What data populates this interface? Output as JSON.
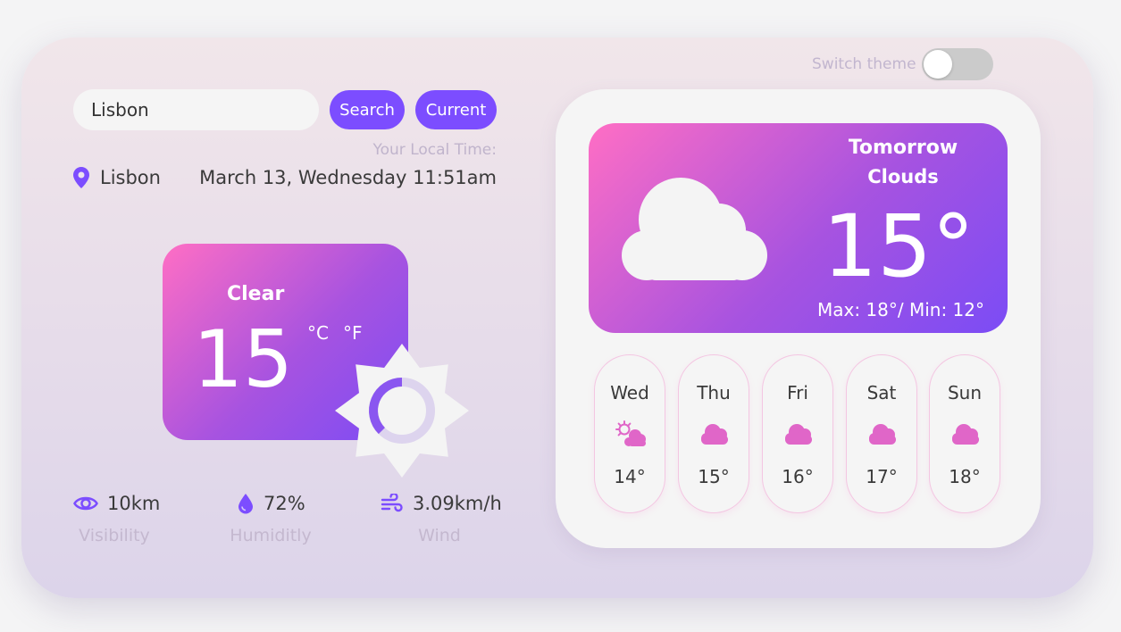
{
  "theme": {
    "label": "Switch theme",
    "dark_mode": false
  },
  "search": {
    "value": "Lisbon",
    "search_label": "Search",
    "current_label": "Current"
  },
  "location": {
    "city": "Lisbon",
    "local_time_label": "Your Local Time:",
    "datetime": "March 13, Wednesday 11:51am"
  },
  "current": {
    "condition": "Clear",
    "temperature": "15",
    "unit_c": "°C",
    "unit_f": "°F",
    "icon": "sun-icon"
  },
  "stats": [
    {
      "value": "10km",
      "label": "Visibility",
      "icon": "eye-icon"
    },
    {
      "value": "72%",
      "label": "Humiditly",
      "icon": "droplet-icon"
    },
    {
      "value": "3.09km/h",
      "label": "Wind",
      "icon": "wind-icon"
    }
  ],
  "tomorrow": {
    "title": "Tomorrow",
    "condition": "Clouds",
    "temperature": "15°",
    "range": "Max: 18°/ Min: 12°",
    "icon": "cloud-icon"
  },
  "forecast": [
    {
      "day": "Wed",
      "temp": "14°",
      "icon": "sun-cloud-icon"
    },
    {
      "day": "Thu",
      "temp": "15°",
      "icon": "cloud-icon"
    },
    {
      "day": "Fri",
      "temp": "16°",
      "icon": "cloud-icon"
    },
    {
      "day": "Sat",
      "temp": "17°",
      "icon": "cloud-icon"
    },
    {
      "day": "Sun",
      "temp": "18°",
      "icon": "cloud-icon"
    }
  ],
  "colors": {
    "accent": "#7c4dff",
    "gradient_start": "#ff6ec4",
    "gradient_end": "#7b4cf5",
    "forecast_icon": "#e066c8"
  }
}
